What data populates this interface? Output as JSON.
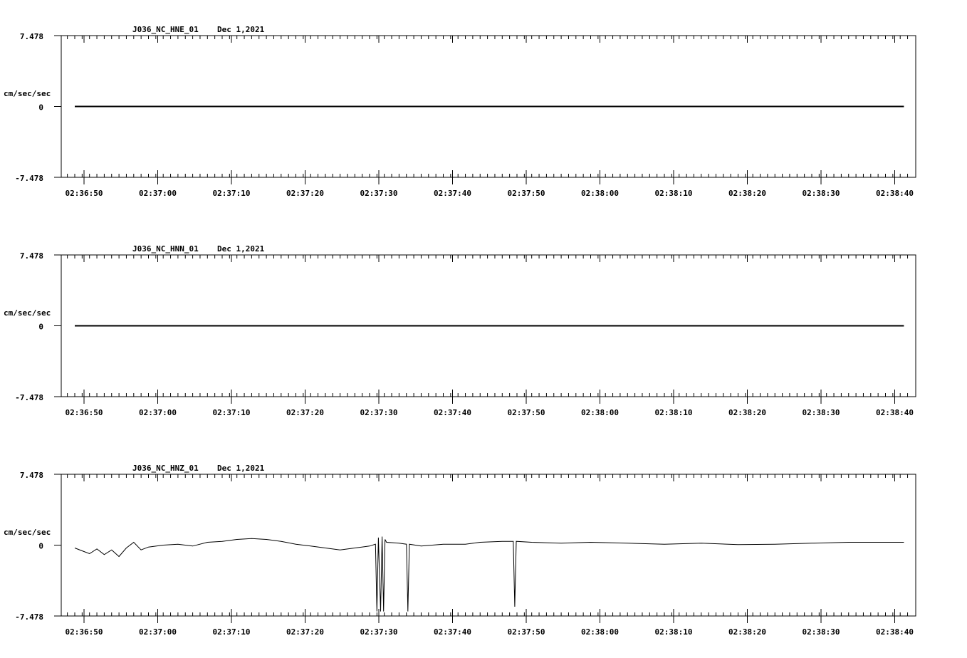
{
  "chart_data": [
    {
      "type": "line",
      "station": "J036_NC_HNE_01",
      "date": "Dec 1,2021",
      "ylabel": "cm/sec/sec",
      "ytick_labels": [
        "7.478",
        "0",
        "-7.478"
      ],
      "ylim": [
        -7.478,
        7.478
      ],
      "xlim_seconds_after_02_36_49": [
        0,
        112.5
      ],
      "x_tick_labels": [
        "02:36:50",
        "02:37:00",
        "02:37:10",
        "02:37:20",
        "02:37:30",
        "02:37:40",
        "02:37:50",
        "02:38:00",
        "02:38:10",
        "02:38:20",
        "02:38:30",
        "02:38:40"
      ],
      "series": [
        {
          "values": [
            [
              0.0,
              0.0
            ],
            [
              112.5,
              0.0
            ]
          ]
        }
      ]
    },
    {
      "type": "line",
      "station": "J036_NC_HNN_01",
      "date": "Dec 1,2021",
      "ylabel": "cm/sec/sec",
      "ytick_labels": [
        "7.478",
        "0",
        "-7.478"
      ],
      "ylim": [
        -7.478,
        7.478
      ],
      "x_tick_labels": [
        "02:36:50",
        "02:37:00",
        "02:37:10",
        "02:37:20",
        "02:37:30",
        "02:37:40",
        "02:37:50",
        "02:38:00",
        "02:38:10",
        "02:38:20",
        "02:38:30",
        "02:38:40"
      ],
      "series": [
        {
          "values": [
            [
              0.0,
              0.0
            ],
            [
              112.5,
              0.0
            ]
          ]
        }
      ]
    },
    {
      "type": "line",
      "station": "J036_NC_HNZ_01",
      "date": "Dec 1,2021",
      "ylabel": "cm/sec/sec",
      "ytick_labels": [
        "7.478",
        "0",
        "-7.478"
      ],
      "ylim": [
        -7.478,
        7.478
      ],
      "x_tick_labels": [
        "02:36:50",
        "02:37:00",
        "02:37:10",
        "02:37:20",
        "02:37:30",
        "02:37:40",
        "02:37:50",
        "02:38:00",
        "02:38:10",
        "02:38:20",
        "02:38:30",
        "02:38:40"
      ],
      "series": [
        {
          "values": [
            [
              0.0,
              -0.3
            ],
            [
              1.0,
              -0.6
            ],
            [
              2.0,
              -0.9
            ],
            [
              3.0,
              -0.4
            ],
            [
              4.0,
              -1.0
            ],
            [
              5.0,
              -0.5
            ],
            [
              6.0,
              -1.2
            ],
            [
              7.0,
              -0.3
            ],
            [
              8.0,
              0.3
            ],
            [
              9.0,
              -0.5
            ],
            [
              10.0,
              -0.2
            ],
            [
              12.0,
              0.0
            ],
            [
              14.0,
              0.1
            ],
            [
              16.0,
              -0.1
            ],
            [
              18.0,
              0.3
            ],
            [
              20.0,
              0.4
            ],
            [
              22.0,
              0.6
            ],
            [
              24.0,
              0.7
            ],
            [
              26.0,
              0.6
            ],
            [
              28.0,
              0.4
            ],
            [
              30.0,
              0.1
            ],
            [
              32.0,
              -0.1
            ],
            [
              34.0,
              -0.3
            ],
            [
              36.0,
              -0.5
            ],
            [
              38.0,
              -0.3
            ],
            [
              40.0,
              -0.1
            ],
            [
              40.8,
              0.1
            ],
            [
              41.0,
              -7.0
            ],
            [
              41.2,
              0.8
            ],
            [
              41.5,
              -7.0
            ],
            [
              41.7,
              0.9
            ],
            [
              41.9,
              -7.0
            ],
            [
              42.1,
              0.6
            ],
            [
              42.3,
              0.3
            ],
            [
              44.0,
              0.2
            ],
            [
              45.0,
              0.1
            ],
            [
              45.2,
              -7.0
            ],
            [
              45.4,
              0.1
            ],
            [
              47.0,
              -0.1
            ],
            [
              50.0,
              0.1
            ],
            [
              53.0,
              0.1
            ],
            [
              55.0,
              0.3
            ],
            [
              58.0,
              0.4
            ],
            [
              59.5,
              0.4
            ],
            [
              59.7,
              -6.5
            ],
            [
              59.9,
              0.4
            ],
            [
              62.0,
              0.3
            ],
            [
              66.0,
              0.2
            ],
            [
              70.0,
              0.3
            ],
            [
              75.0,
              0.2
            ],
            [
              80.0,
              0.1
            ],
            [
              85.0,
              0.2
            ],
            [
              90.0,
              0.05
            ],
            [
              95.0,
              0.1
            ],
            [
              100.0,
              0.2
            ],
            [
              105.0,
              0.3
            ],
            [
              112.5,
              0.3
            ]
          ]
        }
      ]
    }
  ]
}
